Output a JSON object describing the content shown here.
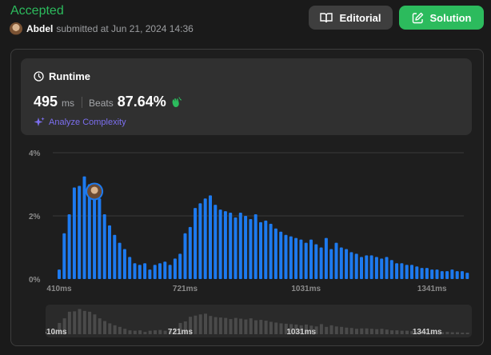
{
  "submission": {
    "status": "Accepted",
    "user": "Abdel",
    "submitted_text": "submitted at Jun 21, 2024 14:36"
  },
  "buttons": {
    "editorial": "Editorial",
    "solution": "Solution"
  },
  "runtime": {
    "title": "Runtime",
    "value": "495",
    "unit": "ms",
    "beats_label": "Beats",
    "beats_value": "87.64%",
    "analyze_label": "Analyze Complexity"
  },
  "colors": {
    "accepted": "#2cbb5d",
    "bar": "#1d7aef",
    "analyze": "#7c6ff0",
    "nav_bar": "#4a4a4a"
  },
  "icons": {
    "editorial": "book-icon",
    "solution": "edit-icon",
    "runtime": "clock-icon",
    "beats": "clap-icon",
    "analyze": "sparkle-icon"
  },
  "chart_data": {
    "type": "bar",
    "ylim": [
      0,
      4
    ],
    "y_ticks": [
      "0%",
      "2%",
      "4%"
    ],
    "x_ticks": [
      "410ms",
      "721ms",
      "1031ms",
      "1341ms"
    ],
    "grid": true,
    "highlight_index": 7,
    "series": [
      {
        "values": [
          0.3,
          1.45,
          2.05,
          2.9,
          2.95,
          3.25,
          3.0,
          2.9,
          2.55,
          2.05,
          1.7,
          1.4,
          1.15,
          0.95,
          0.7,
          0.5,
          0.45,
          0.5,
          0.3,
          0.45,
          0.5,
          0.55,
          0.45,
          0.65,
          0.8,
          1.45,
          1.65,
          2.25,
          2.4,
          2.55,
          2.65,
          2.35,
          2.2,
          2.15,
          2.1,
          1.95,
          2.1,
          2.0,
          1.9,
          2.05,
          1.8,
          1.85,
          1.75,
          1.6,
          1.5,
          1.4,
          1.35,
          1.3,
          1.25,
          1.15,
          1.25,
          1.1,
          1.0,
          1.3,
          0.95,
          1.15,
          1.0,
          0.95,
          0.85,
          0.8,
          0.7,
          0.75,
          0.75,
          0.7,
          0.65,
          0.7,
          0.6,
          0.5,
          0.5,
          0.45,
          0.45,
          0.4,
          0.35,
          0.35,
          0.3,
          0.3,
          0.25,
          0.25,
          0.3,
          0.25,
          0.25,
          0.2,
          0.2
        ]
      }
    ]
  }
}
